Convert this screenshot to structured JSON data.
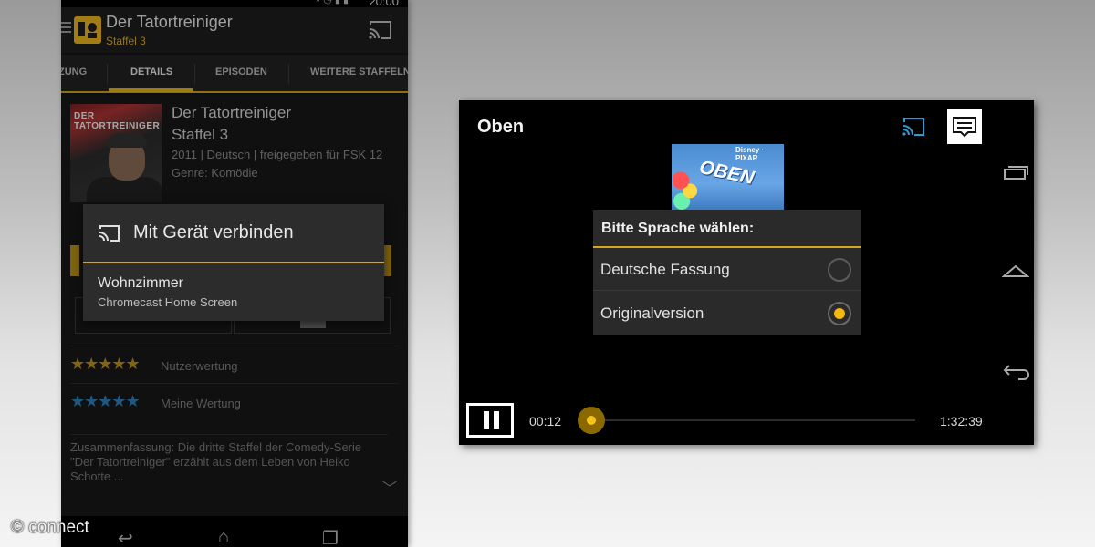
{
  "phone": {
    "status_time": "20:00",
    "status_icons": "▾◷▮▮",
    "appbar": {
      "title": "Der Tatortreiniger",
      "subtitle": "Staffel 3"
    },
    "tabs": [
      {
        "label": "ZUNG",
        "active": false
      },
      {
        "label": "DETAILS",
        "active": true
      },
      {
        "label": "EPISODEN",
        "active": false
      },
      {
        "label": "WEITERE STAFFELN",
        "active": false
      }
    ],
    "details": {
      "poster_title": "DER TATORTREINIGER",
      "title": "Der Tatortreiniger",
      "season": "Staffel 3",
      "meta": "2011 | Deutsch | freigegeben für FSK 12",
      "genre": "Genre: Komödie"
    },
    "ratings": [
      {
        "stars": "★★★★★",
        "label": "Nutzerwertung",
        "color": "#b9911e"
      },
      {
        "stars": "★★★★★",
        "label": "Meine Wertung",
        "color": "#2c7fb8"
      }
    ],
    "summary": "Zusammenfassung: Die dritte Staffel der Comedy-Serie \"Der Tatortreiniger\" erzählt aus dem Leben von Heiko Schotte ...",
    "cast_dialog": {
      "title": "Mit Gerät verbinden",
      "device_name": "Wohnzimmer",
      "device_sub": "Chromecast Home Screen"
    },
    "accent_color": "#e3b21c"
  },
  "player": {
    "movie_title": "Oben",
    "cover_brand": "Disney · PIXAR",
    "cover_title": "OBEN",
    "language_dialog": {
      "title": "Bitte Sprache wählen:",
      "options": [
        {
          "label": "Deutsche Fassung",
          "selected": false
        },
        {
          "label": "Originalversion",
          "selected": true
        }
      ]
    },
    "elapsed": "00:12",
    "duration": "1:32:39",
    "accent_color": "#f2b80f",
    "cast_icon_color": "#2e9bd6"
  },
  "watermark": "© connect"
}
